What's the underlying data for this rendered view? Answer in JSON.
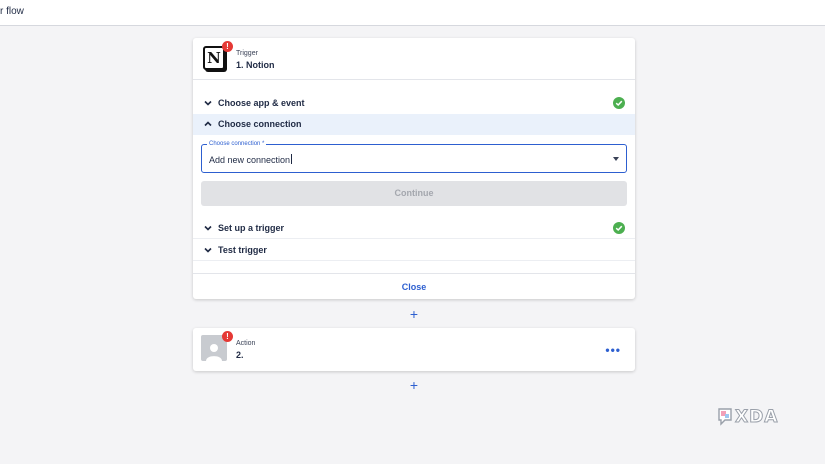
{
  "topbar": {
    "title": "r flow"
  },
  "trigger_card": {
    "kind": "Trigger",
    "name": "1. Notion",
    "app_icon": "notion-logo",
    "app_letter": "N",
    "badge": "!",
    "sections": [
      {
        "label": "Choose app & event",
        "state": "collapsed",
        "complete": true
      },
      {
        "label": "Choose connection",
        "state": "expanded",
        "complete": false
      },
      {
        "label": "Set up a trigger",
        "state": "collapsed",
        "complete": true
      },
      {
        "label": "Test trigger",
        "state": "collapsed",
        "complete": false
      }
    ],
    "connection_field": {
      "label": "Choose connection *",
      "value": "Add new connection"
    },
    "continue_label": "Continue",
    "close_label": "Close"
  },
  "action_card": {
    "kind": "Action",
    "name": "2.",
    "app_icon": "person-icon",
    "badge": "!",
    "menu": "•••"
  },
  "add_step_label": "+",
  "watermark": {
    "text": "XDA"
  },
  "colors": {
    "accent": "#2d5fd0",
    "success": "#4caf50",
    "alert": "#e53935",
    "background": "#f4f4f6"
  }
}
